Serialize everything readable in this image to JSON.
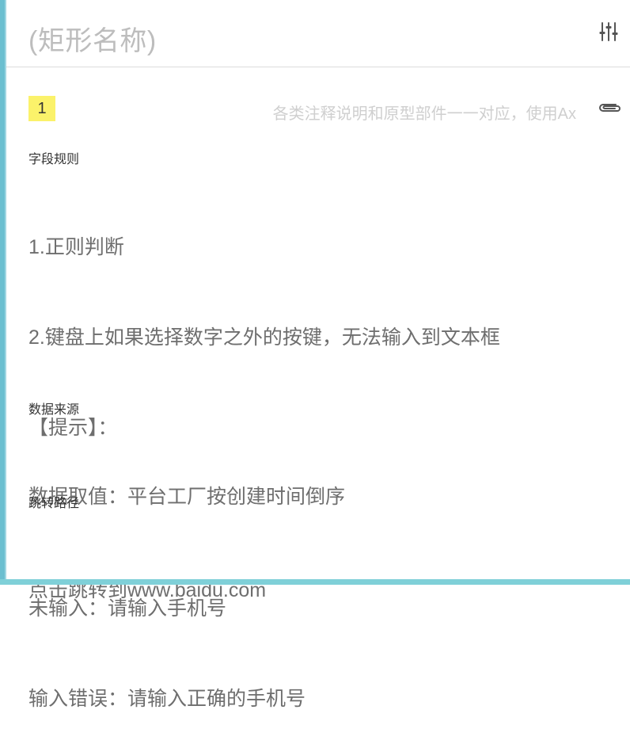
{
  "panel": {
    "title": "(矩形名称)",
    "settings_icon": "sliders-icon",
    "accent_color": "#6bbfd0"
  },
  "note": {
    "badge": "1",
    "badge_color": "#fbf26a",
    "hint": "各类注释说明和原型部件一一对应，使用Ax",
    "attachment_icon": "paperclip-icon"
  },
  "sections": [
    {
      "label": "字段规则",
      "lines": [
        "1.正则判断",
        "2.键盘上如果选择数字之外的按键，无法输入到文本框",
        "【提示】：",
        "",
        "未输入：请输入手机号",
        "输入错误：请输入正确的手机号"
      ]
    },
    {
      "label": "数据来源",
      "lines": [
        "数据取值：平台工厂按创建时间倒序"
      ]
    },
    {
      "label": "跳转路径",
      "lines": [
        "点击跳转到www.baidu.com"
      ]
    }
  ]
}
